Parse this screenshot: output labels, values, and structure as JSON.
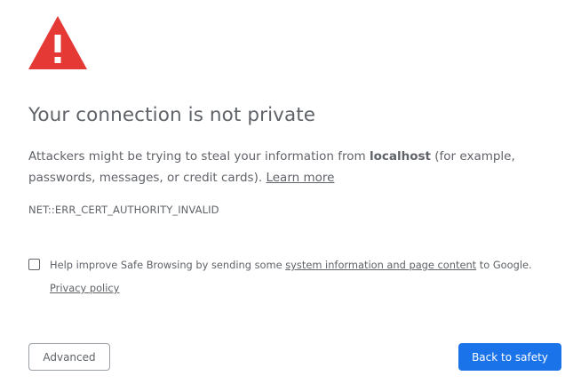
{
  "icon": "warning-triangle-icon",
  "colors": {
    "icon_red": "#e53935",
    "text": "#5f6368",
    "primary_button": "#1a73e8"
  },
  "heading": "Your connection is not private",
  "explanation": {
    "prefix": "Attackers might be trying to steal your information from ",
    "host": "localhost",
    "suffix": " (for example, passwords, messages, or credit cards). ",
    "learn_more": "Learn more"
  },
  "error_code": "NET::ERR_CERT_AUTHORITY_INVALID",
  "safe_browsing": {
    "checked": false,
    "text_prefix": "Help improve Safe Browsing by sending some ",
    "link": "system information and page content",
    "text_suffix": " to Google.",
    "privacy_link": "Privacy policy"
  },
  "buttons": {
    "advanced": "Advanced",
    "back_to_safety": "Back to safety"
  }
}
